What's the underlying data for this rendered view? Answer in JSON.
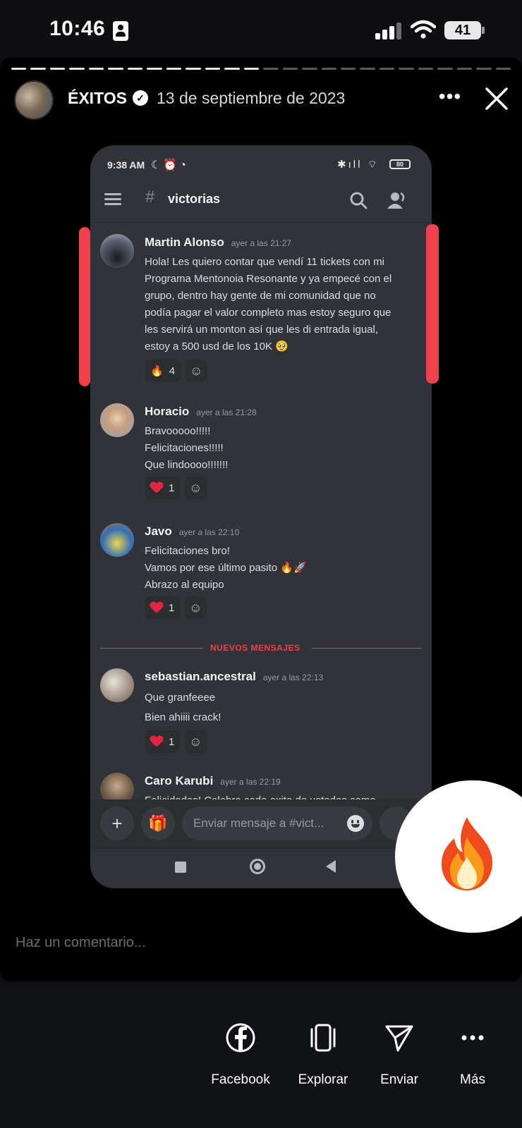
{
  "status_bar": {
    "time": "10:46",
    "battery": "41"
  },
  "story": {
    "username": "ÉXITOS",
    "date": "13 de septiembre de 2023",
    "progress_segments_total": 26,
    "progress_segments_done": 13
  },
  "phone": {
    "status_time": "9:38 AM",
    "battery": "80",
    "channel": "victorias",
    "messages": [
      {
        "name": "Martin Alonso",
        "time": "ayer a las 21:27",
        "lines": [
          "Hola! Les quiero contar que vendí 11 tickets con mi",
          "Programa Mentonoia Resonante y ya empecé con el",
          "grupo, dentro hay gente de mi comunidad que no",
          "podía pagar el valor completo mas estoy seguro que",
          "les servirá un monton así que les di entrada igual,",
          "estoy a 500 usd de los 10K 🥹"
        ],
        "reaction_emoji": "🔥",
        "reaction_count": "4"
      },
      {
        "name": "Horacio",
        "time": "ayer a las 21:28",
        "lines": [
          "Bravooooo!!!!!",
          "Felicitaciones!!!!!",
          "Que lindoooo!!!!!!!"
        ],
        "reaction_count": "1"
      },
      {
        "name": "Javo",
        "time": "ayer a las 22:10",
        "lines": [
          "Felicitaciones bro!",
          "Vamos por ese último pasito 🔥🚀",
          "Abrazo al equipo"
        ],
        "reaction_count": "1"
      },
      {
        "name": "sebastian.ancestral",
        "time": "ayer a las 22:13",
        "lines": [
          "Que granfeeee",
          "Bien ahiiii crack!"
        ],
        "reaction_count": "1"
      },
      {
        "name": "Caro Karubi",
        "time": "ayer a las 22:19",
        "lines": [
          "Felicidades! Celebro cada exito de ustedes como"
        ]
      }
    ],
    "divider": "NUEVOS MENSAJES",
    "composer_placeholder": "Enviar mensaje a #vict..."
  },
  "comment_placeholder": "Haz un comentario...",
  "actions": [
    {
      "label": "Facebook",
      "icon": "facebook-icon"
    },
    {
      "label": "Explorar",
      "icon": "explore-icon"
    },
    {
      "label": "Enviar",
      "icon": "send-icon"
    },
    {
      "label": "Más",
      "icon": "more-icon"
    }
  ],
  "colors": {
    "highlight": "#f1414b",
    "discord_bg": "#313338",
    "new_messages": "#f23f43"
  }
}
